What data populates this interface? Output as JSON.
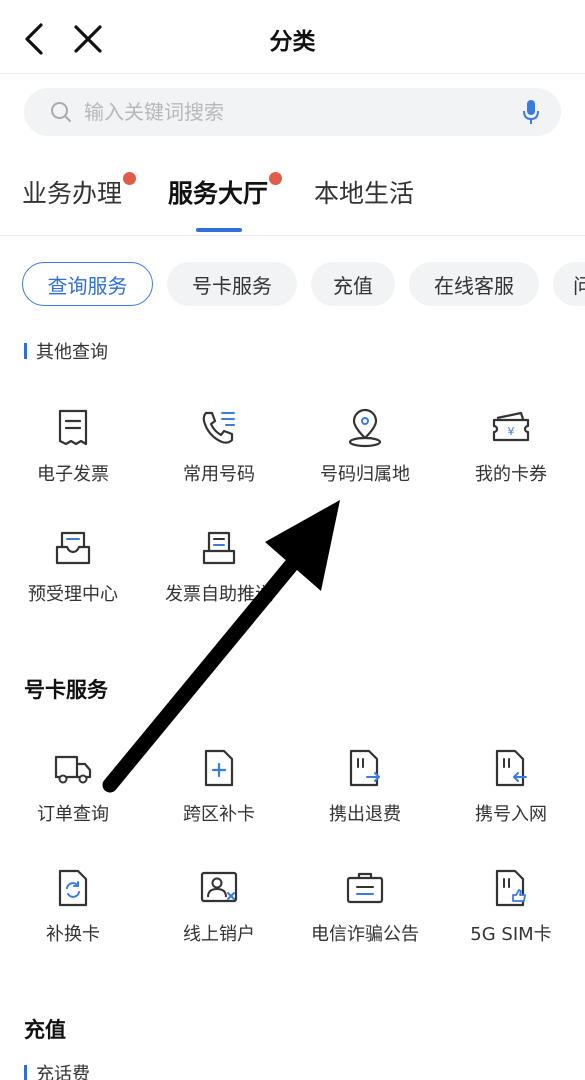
{
  "header": {
    "title": "分类",
    "back_icon": "chevron-left-icon",
    "close_icon": "close-icon"
  },
  "search": {
    "placeholder": "输入关键词搜索",
    "icon": "search-icon",
    "voice_icon": "microphone-icon"
  },
  "tabs": [
    {
      "label": "业务办理",
      "badge": true
    },
    {
      "label": "服务大厅",
      "badge": true,
      "active": true
    },
    {
      "label": "本地生活",
      "badge": false
    }
  ],
  "chips": [
    {
      "label": "查询服务",
      "active": true
    },
    {
      "label": "号卡服务"
    },
    {
      "label": "充值"
    },
    {
      "label": "在线客服"
    },
    {
      "label": "问"
    }
  ],
  "query_section": {
    "subheading": "其他查询",
    "items": [
      {
        "label": "电子发票",
        "icon": "receipt-icon"
      },
      {
        "label": "常用号码",
        "icon": "phone-list-icon"
      },
      {
        "label": "号码归属地",
        "icon": "location-pin-icon"
      },
      {
        "label": "我的卡券",
        "icon": "coupon-icon"
      },
      {
        "label": "预受理中心",
        "icon": "inbox-document-icon"
      },
      {
        "label": "发票自助推送",
        "icon": "invoice-push-icon"
      }
    ]
  },
  "card_section": {
    "title": "号卡服务",
    "items": [
      {
        "label": "订单查询",
        "icon": "delivery-truck-icon"
      },
      {
        "label": "跨区补卡",
        "icon": "document-plus-icon"
      },
      {
        "label": "携出退费",
        "icon": "sim-card-out-icon"
      },
      {
        "label": "携号入网",
        "icon": "sim-card-in-icon"
      },
      {
        "label": "补换卡",
        "icon": "sim-card-refresh-icon"
      },
      {
        "label": "线上销户",
        "icon": "id-card-cancel-icon"
      },
      {
        "label": "电信诈骗公告",
        "icon": "announcement-briefcase-icon"
      },
      {
        "label": "5G SIM卡",
        "icon": "sim-card-5g-icon"
      }
    ]
  },
  "recharge_section": {
    "title": "充值",
    "subheading": "充话费"
  },
  "annotation": {
    "icon": "pointer-arrow-icon"
  },
  "colors": {
    "accent": "#2f6fd6",
    "badge": "#e25c4a",
    "chip_bg": "#f2f3f5",
    "icon_stroke": "#333333",
    "icon_accent": "#3a7be0"
  }
}
